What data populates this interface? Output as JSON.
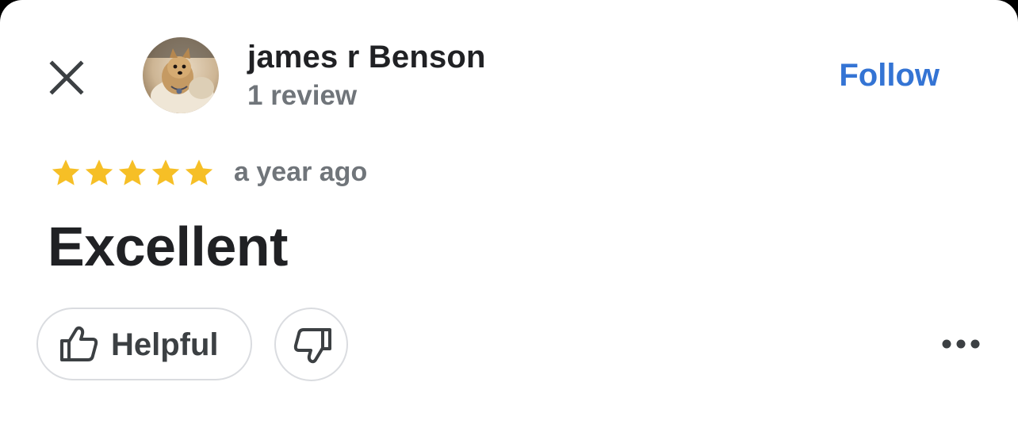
{
  "header": {
    "close_icon": "close-icon",
    "reviewer_name": "james r Benson",
    "review_count": "1 review",
    "follow_label": "Follow"
  },
  "review": {
    "rating": 5,
    "rating_max": 5,
    "date": "a year ago",
    "text": "Excellent"
  },
  "actions": {
    "helpful_label": "Helpful",
    "helpful_icon": "thumbs-up-icon",
    "not_helpful_icon": "thumbs-down-icon",
    "more_icon": "more-horizontal-icon"
  },
  "colors": {
    "accent": "#3474d4",
    "star": "#f6bf26",
    "primary_text": "#202124",
    "secondary_text": "#70757a",
    "border": "#dadce0"
  }
}
